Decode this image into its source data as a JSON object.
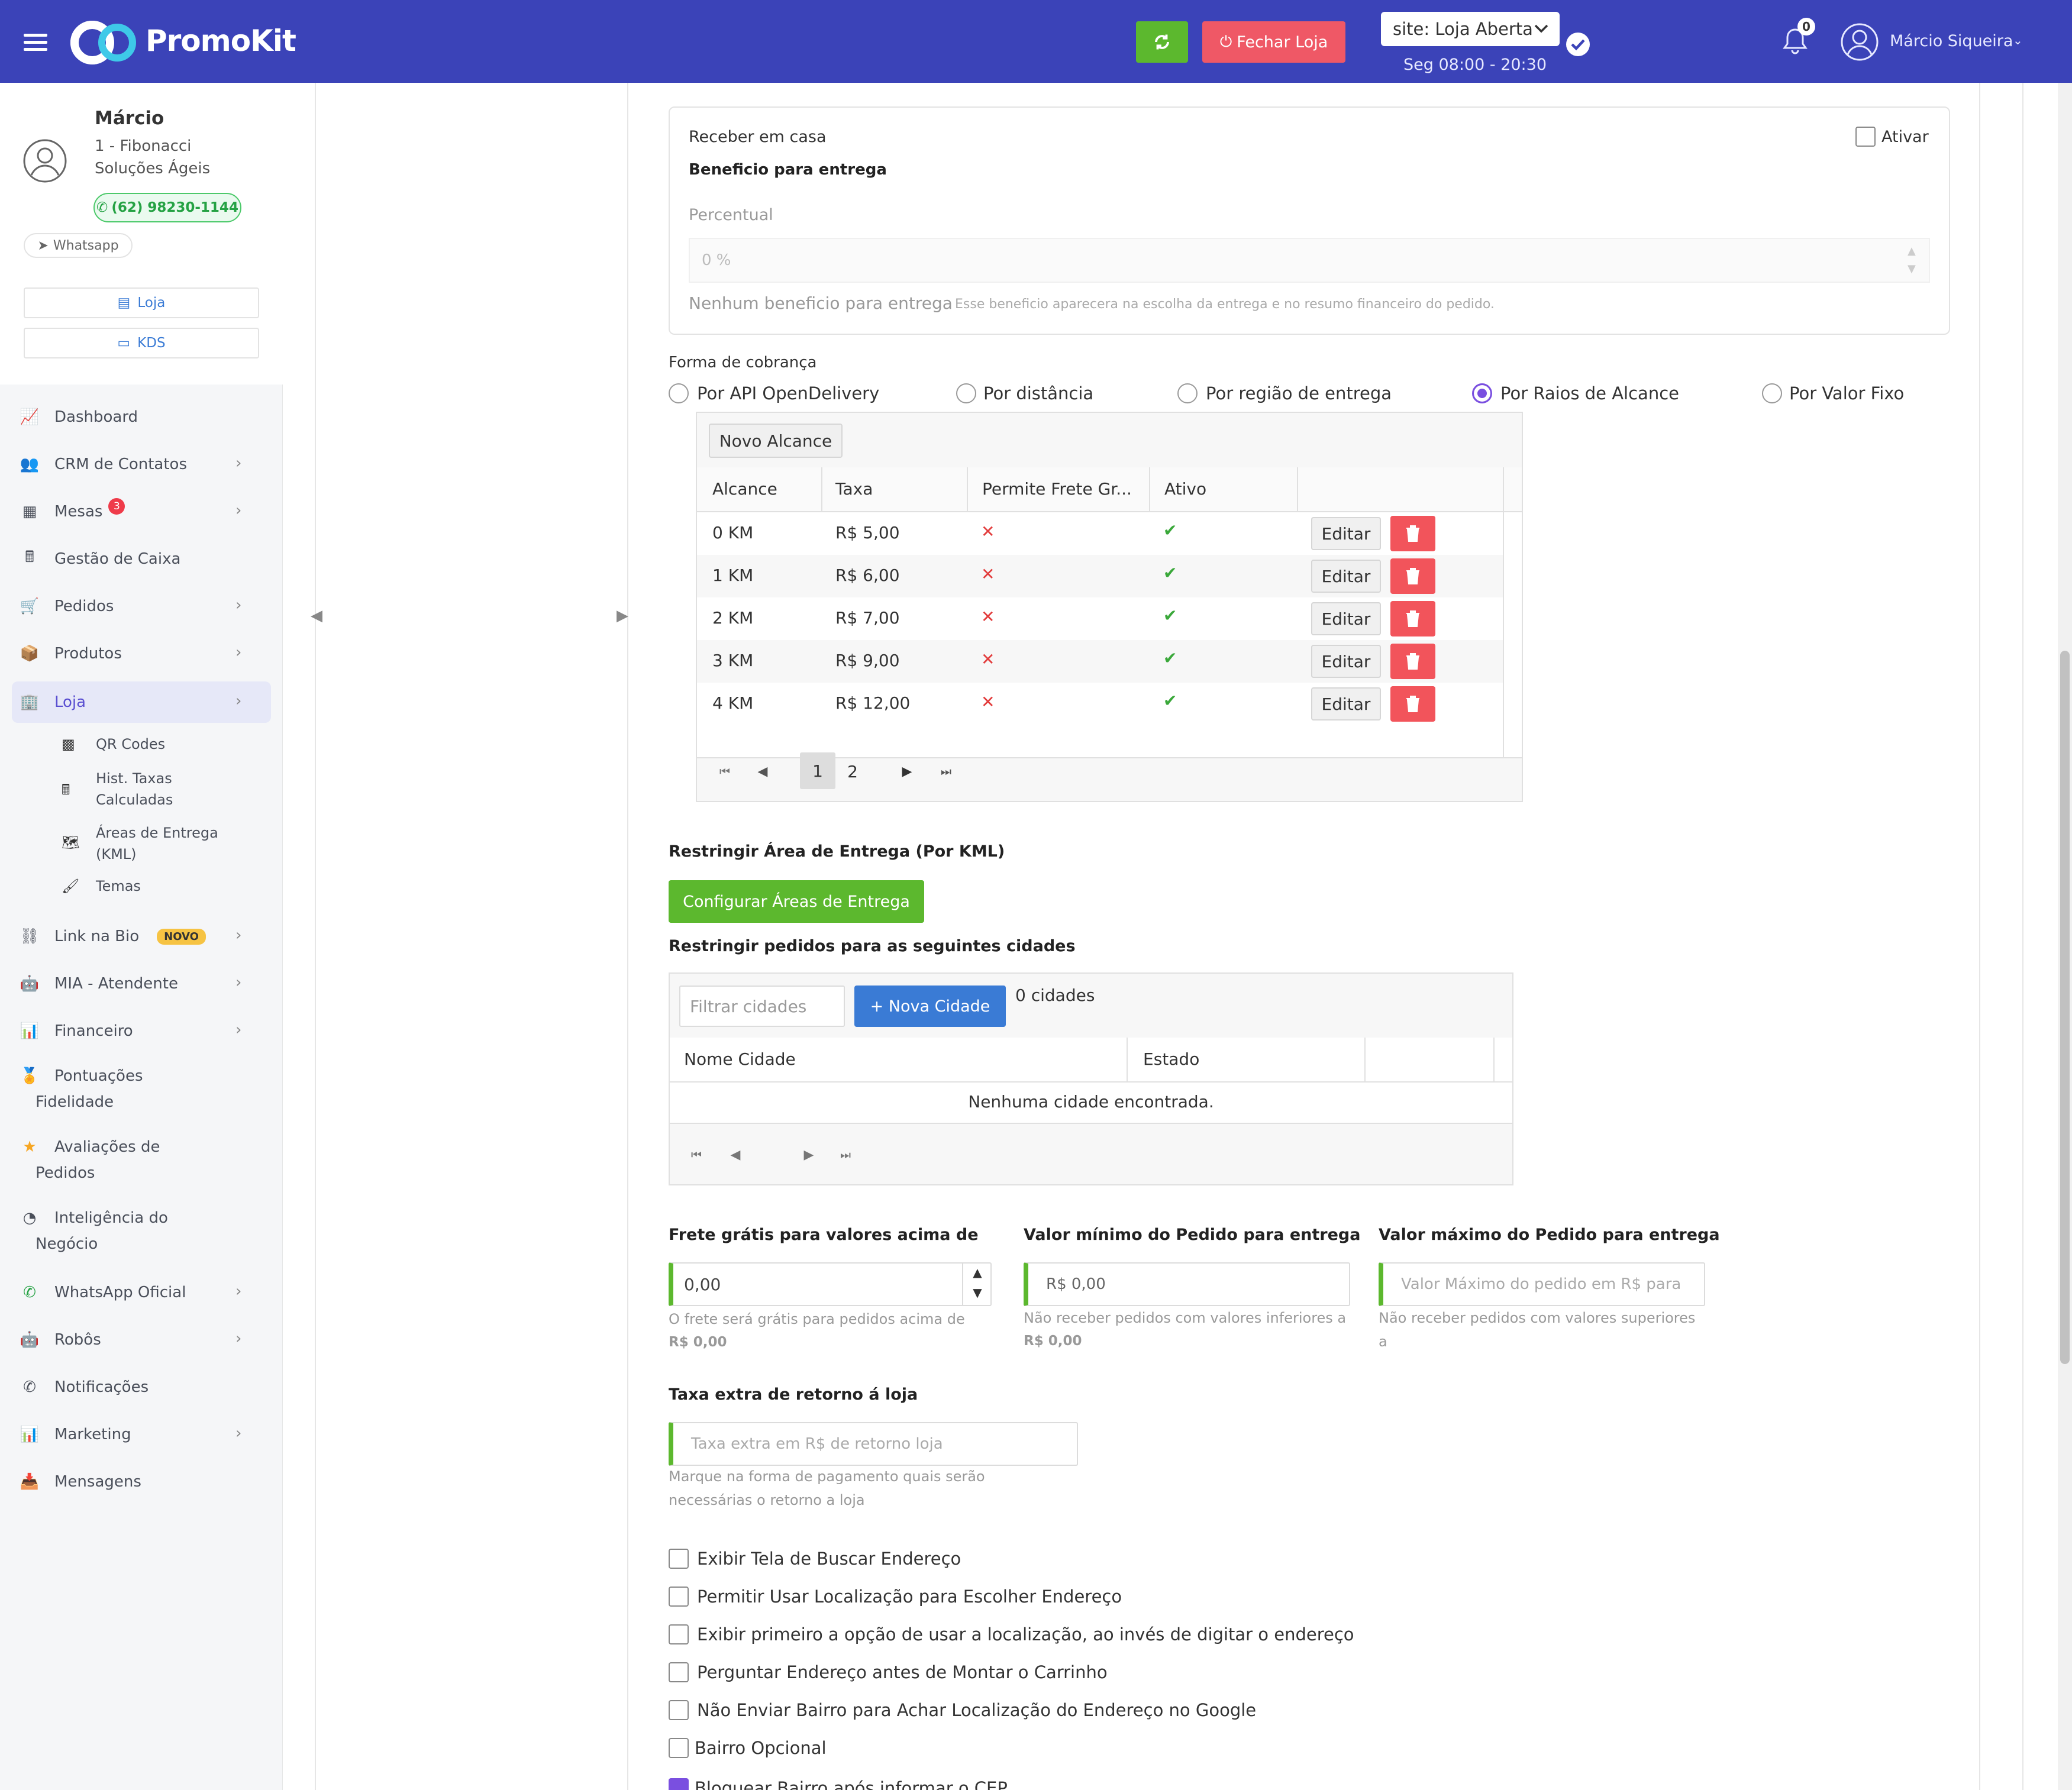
{
  "header": {
    "brand": "PromoKit",
    "close_store": "Fechar Loja",
    "site_status": "site: Loja Aberta",
    "hours": "Seg 08:00 - 20:30",
    "notif_count": "0",
    "user_name": "Márcio Siqueira"
  },
  "profile": {
    "name": "Márcio",
    "company_line1": "1 - Fibonacci",
    "company_line2": "Soluções Ágeis",
    "phone": "(62) 98230-1144",
    "whatsapp": "Whatsapp",
    "btn_store": "Loja",
    "btn_kds": "KDS"
  },
  "sidebar": {
    "dashboard": "Dashboard",
    "crm": "CRM de Contatos",
    "mesas": "Mesas",
    "mesas_badge": "3",
    "caixa": "Gestão de Caixa",
    "pedidos": "Pedidos",
    "produtos": "Produtos",
    "loja": "Loja",
    "qrcodes": "QR Codes",
    "hist1": "Hist. Taxas",
    "hist2": "Calculadas",
    "areas1": "Áreas de Entrega",
    "areas2": "(KML)",
    "temas": "Temas",
    "linkbio": "Link na Bio",
    "novo": "NOVO",
    "mia": "MIA - Atendente",
    "financeiro": "Financeiro",
    "pont1": "Pontuações",
    "pont2": "Fidelidade",
    "aval1": "Avaliações de",
    "aval2": "Pedidos",
    "intel1": "Inteligência do",
    "intel2": "Negócio",
    "whatsapp": "WhatsApp Oficial",
    "robos": "Robôs",
    "notif": "Notificações",
    "marketing": "Marketing",
    "mensagens": "Mensagens"
  },
  "delivery_panel": {
    "title": "Receber em casa",
    "activate": "Ativar",
    "benefit": "Beneficio para entrega",
    "percent_label": "Percentual",
    "percent_placeholder": "0 %",
    "no_benefit": "Nenhum beneficio para entrega",
    "hint": "Esse beneficio aparecera na escolha da entrega e no resumo financeiro do pedido."
  },
  "billing": {
    "label": "Forma de cobrança",
    "options": [
      "Por API OpenDelivery",
      "Por distância",
      "Por região de entrega",
      "Por Raios de Alcance",
      "Por Valor Fixo"
    ],
    "selected": "Por Raios de Alcance"
  },
  "ranges": {
    "new_button": "Novo Alcance",
    "columns": [
      "Alcance",
      "Taxa",
      "Permite Frete Gr...",
      "Ativo"
    ],
    "rows": [
      {
        "range": "0 KM",
        "fee": "R$ 5,00"
      },
      {
        "range": "1 KM",
        "fee": "R$ 6,00"
      },
      {
        "range": "2 KM",
        "fee": "R$ 7,00"
      },
      {
        "range": "3 KM",
        "fee": "R$ 9,00"
      },
      {
        "range": "4 KM",
        "fee": "R$ 12,00"
      }
    ],
    "edit_label": "Editar",
    "pages": [
      "1",
      "2"
    ]
  },
  "kml": {
    "label": "Restringir Área de Entrega (Por KML)",
    "button": "Configurar Áreas de Entrega"
  },
  "cities": {
    "label": "Restringir pedidos para as seguintes cidades",
    "filter_placeholder": "Filtrar cidades",
    "new_button": "+ Nova Cidade",
    "count": "0 cidades",
    "col_name": "Nome Cidade",
    "col_state": "Estado",
    "empty": "Nenhuma cidade encontrada."
  },
  "values": {
    "free_label": "Frete grátis para valores acima de",
    "free_value": "0,00",
    "free_hint1": "O frete será grátis para pedidos acima de",
    "free_hint2": "R$ 0,00",
    "min_label": "Valor mínimo do Pedido para entrega",
    "min_value": "R$ 0,00",
    "min_hint1": "Não receber pedidos com valores inferiores a",
    "min_hint2": "R$ 0,00",
    "max_label": "Valor máximo do Pedido para entrega",
    "max_placeholder": "Valor Máximo do pedido em R$ para",
    "max_hint1": "Não receber pedidos com valores superiores",
    "max_hint2": "a"
  },
  "return_fee": {
    "label": "Taxa extra de retorno á loja",
    "placeholder": "Taxa extra em R$ de retorno loja",
    "hint1": "Marque na forma de pagamento quais serão",
    "hint2": "necessárias o retorno a loja"
  },
  "options": [
    "Exibir Tela de Buscar Endereço",
    "Permitir Usar Localização para Escolher Endereço",
    "Exibir primeiro a opção de usar a localização, ao invés de digitar o endereço",
    "Perguntar Endereço antes de Montar o Carrinho",
    "Não Enviar Bairro para Achar Localização do Endereço no Google",
    "Bairro Opcional",
    "Bloquear Bairro após informar o CEP"
  ],
  "colors": {
    "topbar": "#3b43b8",
    "green": "#5cb82e",
    "red": "#ef5866",
    "blue": "#3a7bd5",
    "purple": "#7a4fe0"
  }
}
